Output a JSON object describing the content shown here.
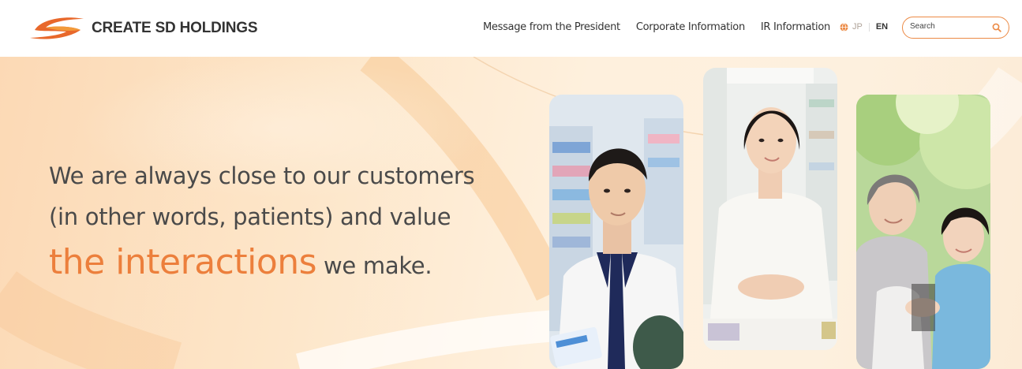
{
  "header": {
    "logo_text": "CREATE SD HOLDINGS",
    "nav": [
      {
        "label": "Message from the President"
      },
      {
        "label": "Corporate Information"
      },
      {
        "label": "IR Information"
      }
    ],
    "lang": {
      "jp": "JP",
      "en": "EN"
    },
    "search": {
      "placeholder": "Search"
    }
  },
  "hero": {
    "line1": "We are always close to our customers",
    "line2": "(in other words, patients) and value",
    "emphasis": "the interactions",
    "tail": "we make."
  },
  "colors": {
    "accent": "#ec7f3c",
    "text": "#4a4a4a"
  },
  "icons": {
    "globe": "globe-icon",
    "search": "search-icon"
  }
}
